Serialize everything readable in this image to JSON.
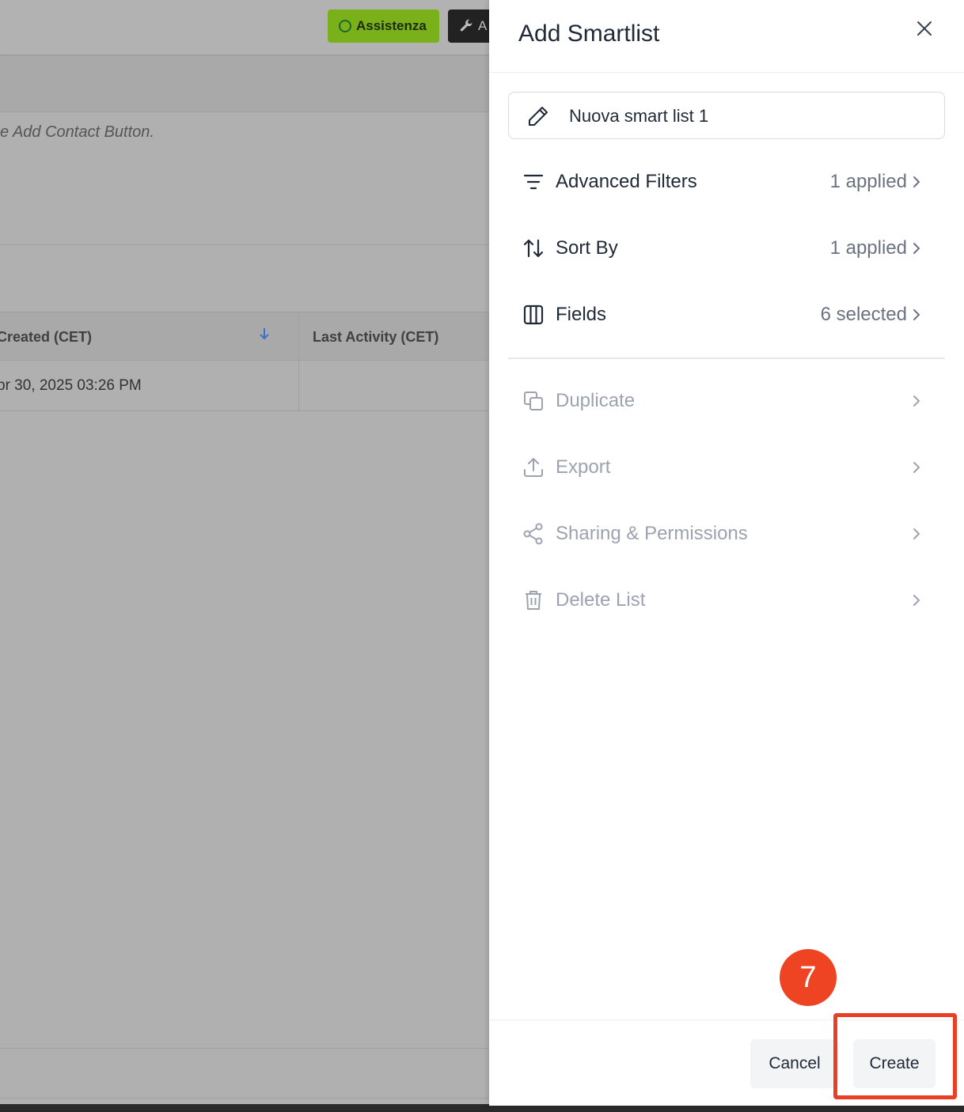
{
  "background": {
    "assist_button": "Assistenza",
    "dark_button": "A",
    "hint_text": "e Add Contact Button.",
    "table": {
      "columns": [
        "Created (CET)",
        "Last Activity (CET)"
      ],
      "rows": [
        [
          "pr 30, 2025  03:26 PM",
          ""
        ]
      ]
    }
  },
  "drawer": {
    "title": "Add Smartlist",
    "name_value": "Nuova smart list 1",
    "items": [
      {
        "label": "Advanced Filters",
        "value": "1 applied",
        "icon": "filter-icon",
        "state": "active"
      },
      {
        "label": "Sort By",
        "value": "1 applied",
        "icon": "sort-icon",
        "state": "active"
      },
      {
        "label": "Fields",
        "value": "6 selected",
        "icon": "columns-icon",
        "state": "active"
      },
      {
        "label": "Duplicate",
        "value": "",
        "icon": "duplicate-icon",
        "state": "disabled"
      },
      {
        "label": "Export",
        "value": "",
        "icon": "export-icon",
        "state": "disabled"
      },
      {
        "label": "Sharing & Permissions",
        "value": "",
        "icon": "share-icon",
        "state": "disabled"
      },
      {
        "label": "Delete List",
        "value": "",
        "icon": "trash-icon",
        "state": "disabled"
      }
    ],
    "footer": {
      "cancel_label": "Cancel",
      "create_label": "Create"
    }
  },
  "tutorial": {
    "step_number": "7",
    "highlight_color": "#ea3e25"
  },
  "colors": {
    "overlay_bg": "#b1b1b1",
    "assist_green": "#7ab01a",
    "text_primary": "#1f2937",
    "text_muted": "#9ca3af",
    "badge": "#ef4423"
  }
}
